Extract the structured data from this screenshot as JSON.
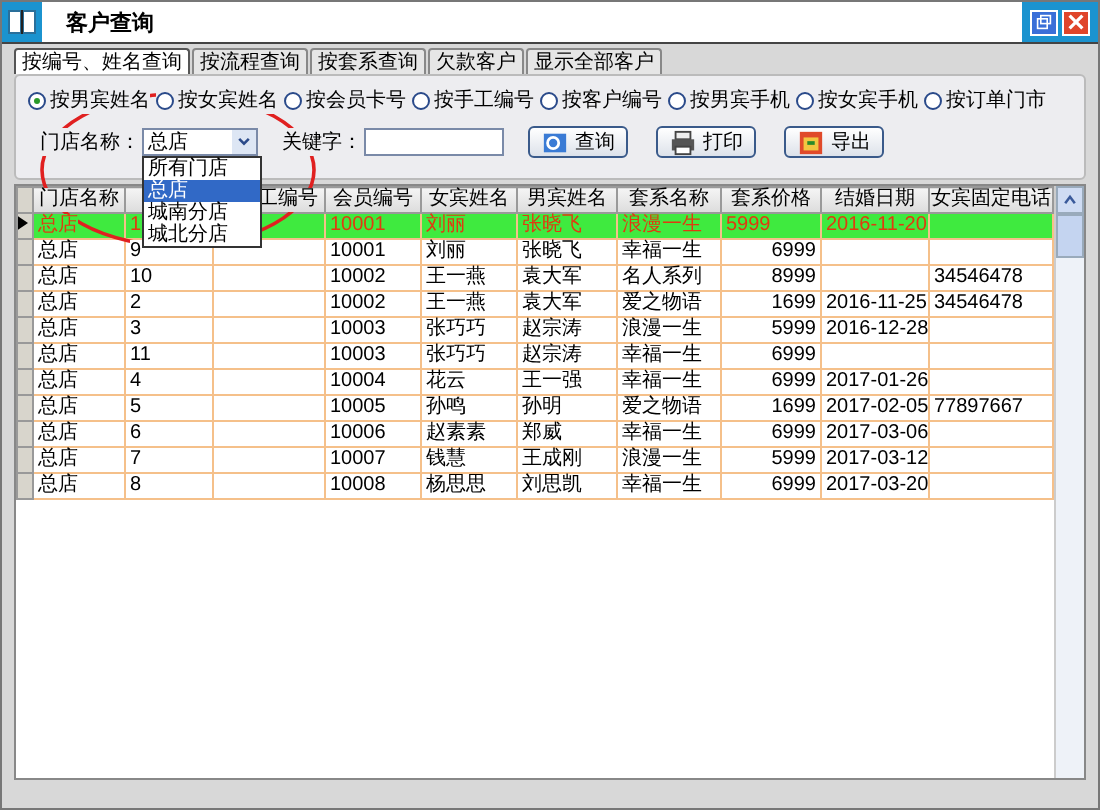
{
  "window": {
    "title": "客户查询"
  },
  "tabs": [
    {
      "label": "按编号、姓名查询",
      "selected": true
    },
    {
      "label": "按流程查询",
      "selected": false
    },
    {
      "label": "按套系查询",
      "selected": false
    },
    {
      "label": "欠款客户",
      "selected": false
    },
    {
      "label": "显示全部客户",
      "selected": false
    }
  ],
  "search_by": [
    {
      "label": "按男宾姓名",
      "selected": true
    },
    {
      "label": "按女宾姓名",
      "selected": false
    },
    {
      "label": "按会员卡号",
      "selected": false
    },
    {
      "label": "按手工编号",
      "selected": false
    },
    {
      "label": "按客户编号",
      "selected": false
    },
    {
      "label": "按男宾手机",
      "selected": false
    },
    {
      "label": "按女宾手机",
      "selected": false
    },
    {
      "label": "按订单门市",
      "selected": false
    }
  ],
  "store": {
    "label": "门店名称：",
    "value": "总店",
    "expanded": true,
    "options": [
      {
        "label": "所有门店",
        "selected": false
      },
      {
        "label": "总店",
        "selected": true
      },
      {
        "label": "城南分店",
        "selected": false
      },
      {
        "label": "城北分店",
        "selected": false
      }
    ]
  },
  "keyword": {
    "label": "关键字："
  },
  "buttons": [
    {
      "label": "查询",
      "kind": "search"
    },
    {
      "label": "打印",
      "kind": "print"
    },
    {
      "label": "导出",
      "kind": "export"
    }
  ],
  "table": {
    "columns": [
      {
        "label": "门店名称"
      },
      {},
      {
        "label": "工编号"
      },
      {
        "label": "会员编号"
      },
      {
        "label": "女宾姓名"
      },
      {
        "label": "男宾姓名"
      },
      {
        "label": "套系名称"
      },
      {
        "label": "套系价格"
      },
      {
        "label": "结婚日期"
      },
      {
        "label": "女宾固定电话"
      }
    ],
    "rows": [
      {
        "selected": true,
        "cells": [
          "总店",
          "1",
          null,
          "10001",
          "刘丽",
          "张晓飞",
          "浪漫一生",
          "5999",
          "2016-11-20",
          null
        ]
      },
      {
        "selected": false,
        "cells": [
          "总店",
          "9",
          null,
          "10001",
          "刘丽",
          "张晓飞",
          "幸福一生",
          "6999",
          null,
          null
        ]
      },
      {
        "selected": false,
        "cells": [
          "总店",
          "10",
          null,
          "10002",
          "王一燕",
          "袁大军",
          "名人系列",
          "8999",
          null,
          "34546478"
        ]
      },
      {
        "selected": false,
        "cells": [
          "总店",
          "2",
          null,
          "10002",
          "王一燕",
          "袁大军",
          "爱之物语",
          "1699",
          "2016-11-25",
          "34546478"
        ]
      },
      {
        "selected": false,
        "cells": [
          "总店",
          "3",
          null,
          "10003",
          "张巧巧",
          "赵宗涛",
          "浪漫一生",
          "5999",
          "2016-12-28",
          null
        ]
      },
      {
        "selected": false,
        "cells": [
          "总店",
          "11",
          null,
          "10003",
          "张巧巧",
          "赵宗涛",
          "幸福一生",
          "6999",
          null,
          null
        ]
      },
      {
        "selected": false,
        "cells": [
          "总店",
          "4",
          null,
          "10004",
          "花云",
          "王一强",
          "幸福一生",
          "6999",
          "2017-01-26",
          null
        ]
      },
      {
        "selected": false,
        "cells": [
          "总店",
          "5",
          null,
          "10005",
          "孙鸣",
          "孙明",
          "爱之物语",
          "1699",
          "2017-02-05",
          "77897667"
        ]
      },
      {
        "selected": false,
        "cells": [
          "总店",
          "6",
          null,
          "10006",
          "赵素素",
          "郑威",
          "幸福一生",
          "6999",
          "2017-03-06",
          null
        ]
      },
      {
        "selected": false,
        "cells": [
          "总店",
          "7",
          null,
          "10007",
          "钱慧",
          "王成刚",
          "浪漫一生",
          "5999",
          "2017-03-12",
          null
        ]
      },
      {
        "selected": false,
        "cells": [
          "总店",
          "8",
          null,
          "10008",
          "杨思思",
          "刘思凯",
          "幸福一生",
          "6999",
          "2017-03-20",
          null
        ]
      }
    ]
  }
}
